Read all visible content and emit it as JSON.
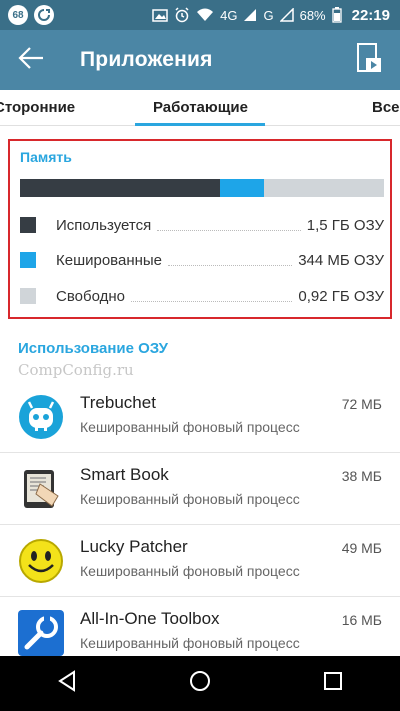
{
  "status_bar": {
    "notif_badge": "68",
    "network": "4G",
    "network2": "G",
    "battery": "68%",
    "time": "22:19"
  },
  "appbar": {
    "title": "Приложения",
    "back_icon": "arrow-left-icon",
    "media_icon": "media-play-icon"
  },
  "tabs": [
    {
      "label": "Сторонние",
      "selected": false
    },
    {
      "label": "Работающие",
      "selected": true
    },
    {
      "label": "Все",
      "selected": false
    }
  ],
  "memory": {
    "title": "Память",
    "bar": {
      "used_fraction": 0.55,
      "cached_fraction": 0.12
    },
    "rows": [
      {
        "label": "Используется",
        "value": "1,5 ГБ ОЗУ",
        "color": "#363d44"
      },
      {
        "label": "Кешированные",
        "value": "344 МБ ОЗУ",
        "color": "#1ea5e8"
      },
      {
        "label": "Свободно",
        "value": "0,92 ГБ ОЗУ",
        "color": "#d0d5d9"
      }
    ]
  },
  "ram_usage": {
    "title": "Использование ОЗУ",
    "watermark": "CompConfig.ru",
    "apps": [
      {
        "name": "Trebuchet",
        "subtitle": "Кешированный фоновый процесс",
        "size": "72 МБ",
        "icon": "cyanogen-mascot-icon"
      },
      {
        "name": "Smart Book",
        "subtitle": "Кешированный фоновый процесс",
        "size": "38 МБ",
        "icon": "book-reader-icon"
      },
      {
        "name": "Lucky Patcher",
        "subtitle": "Кешированный фоновый процесс",
        "size": "49 МБ",
        "icon": "smiley-face-icon"
      },
      {
        "name": "All-In-One Toolbox",
        "subtitle": "Кешированный фоновый процесс",
        "size": "16 МБ",
        "icon": "wrench-icon"
      }
    ]
  },
  "navbar": {
    "back_icon": "nav-back-triangle-icon",
    "home_icon": "nav-home-circle-icon",
    "recents_icon": "nav-recents-square-icon"
  }
}
